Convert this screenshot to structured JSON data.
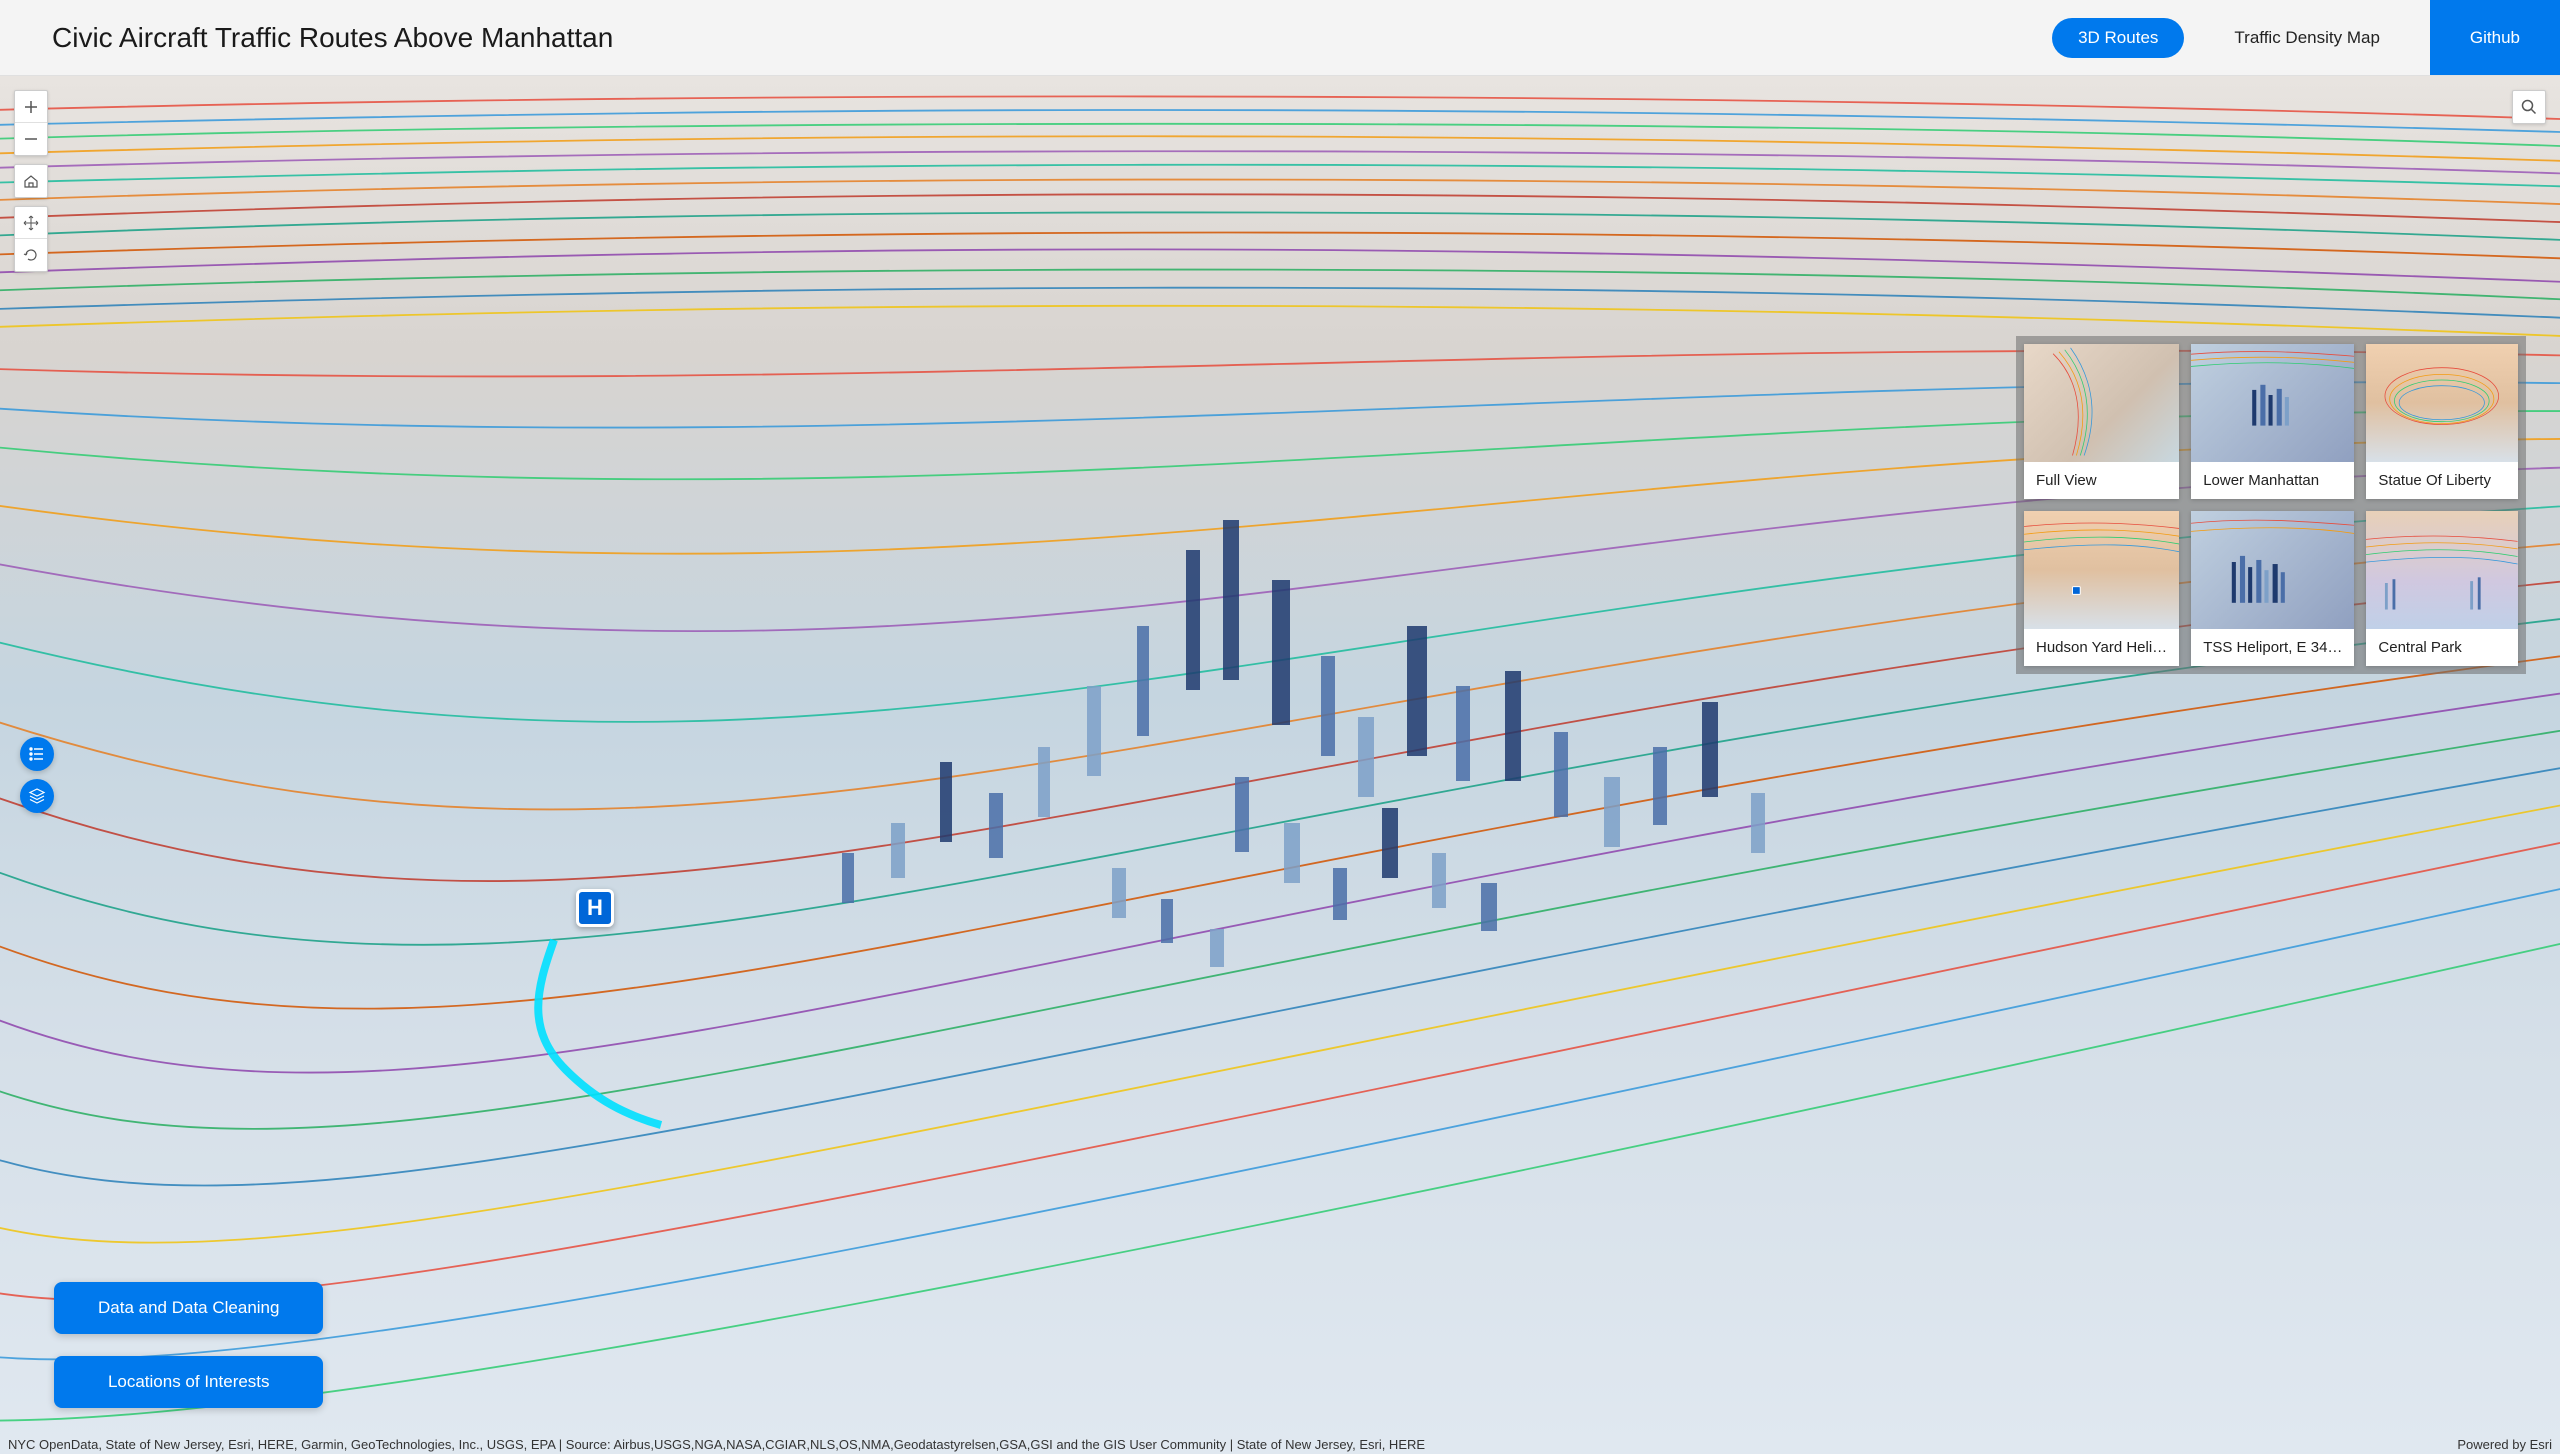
{
  "header": {
    "title": "Civic Aircraft Traffic Routes Above Manhattan",
    "nav": {
      "routes3d": "3D Routes",
      "density": "Traffic Density Map",
      "github": "Github"
    }
  },
  "heliport_marker": "H",
  "bottom_buttons": {
    "data_cleaning": "Data and Data Cleaning",
    "locations": "Locations of Interests"
  },
  "bookmarks": [
    {
      "label": "Full View"
    },
    {
      "label": "Lower Manhattan"
    },
    {
      "label": "Statue Of Liberty"
    },
    {
      "label": "Hudson Yard Heli…"
    },
    {
      "label": "TSS Heliport, E 34…"
    },
    {
      "label": "Central Park"
    }
  ],
  "footer": {
    "attribution": "NYC OpenData, State of New Jersey, Esri, HERE, Garmin, GeoTechnologies, Inc., USGS, EPA | Source: Airbus,USGS,NGA,NASA,CGIAR,NLS,OS,NMA,Geodatastyrelsen,GSA,GSI and the GIS User Community | State of New Jersey, Esri, HERE",
    "powered": "Powered by Esri"
  },
  "colors": {
    "accent": "#0079ed"
  }
}
